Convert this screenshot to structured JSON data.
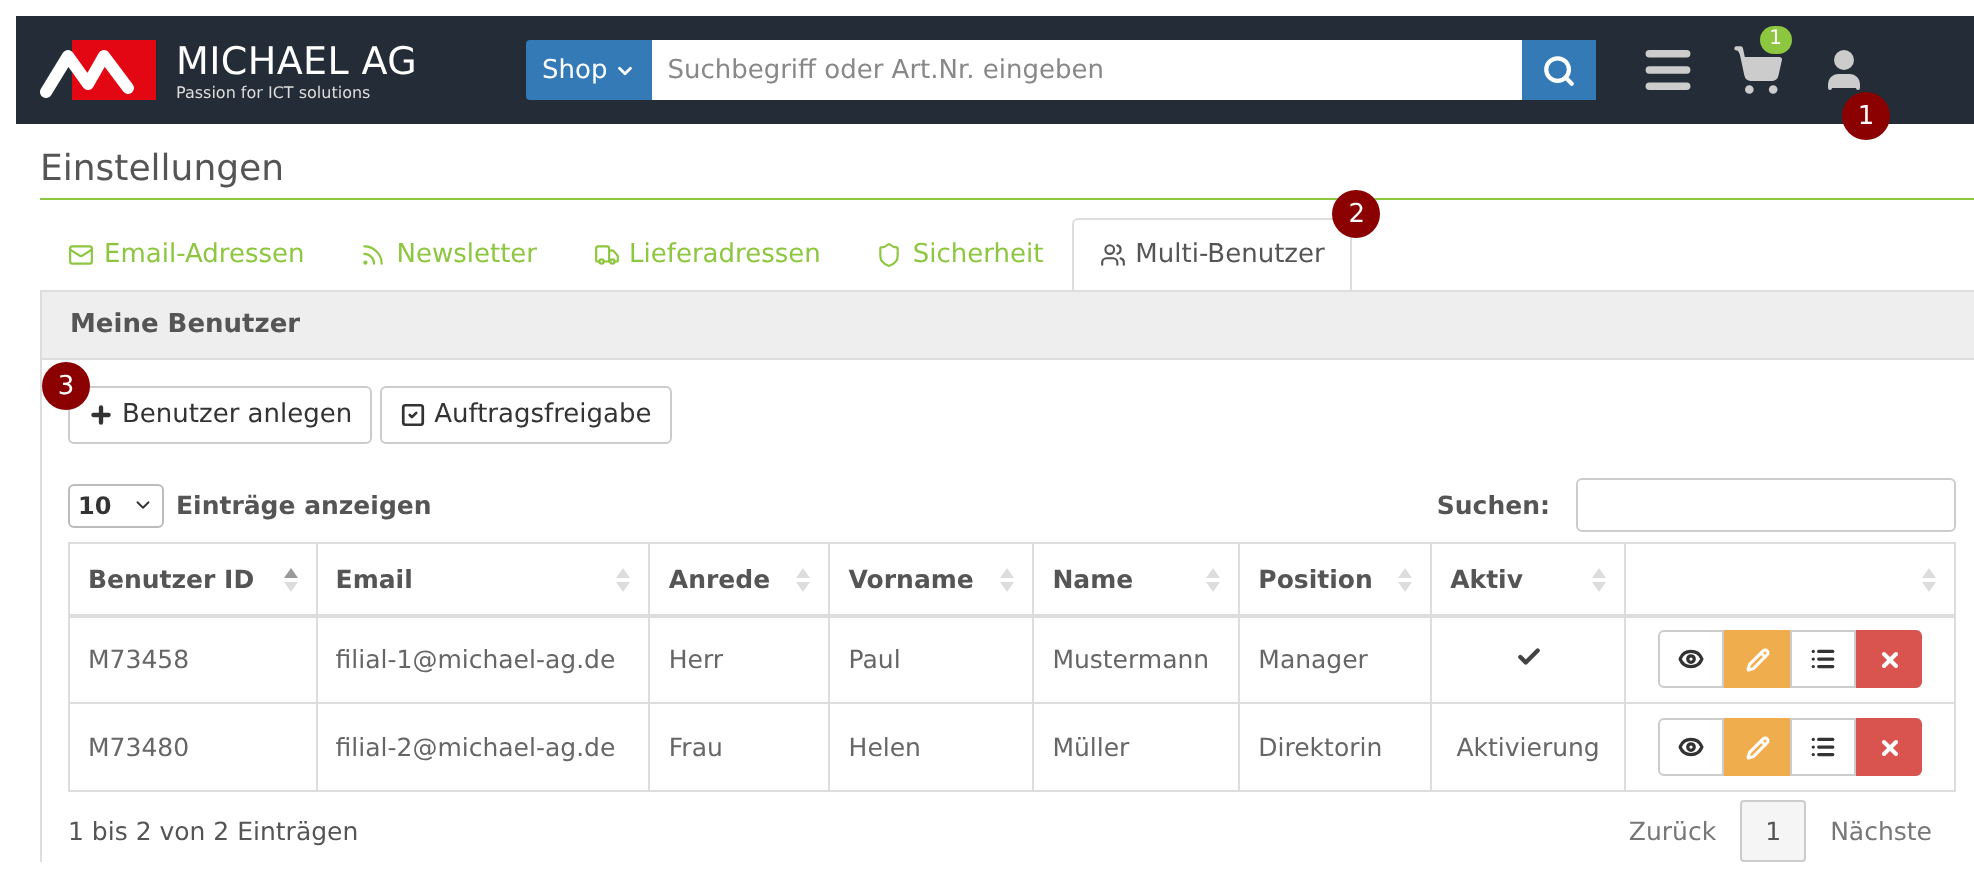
{
  "navbar": {
    "brand": "MICHAEL AG",
    "tagline": "Passion for ICT solutions",
    "shop_button": "Shop",
    "search": {
      "placeholder": "Suchbegriff oder Art.Nr. eingeben"
    },
    "cart_count": "1",
    "user_marker": "1"
  },
  "page_title": "Einstellungen",
  "tabs": [
    {
      "label": "Email-Adressen",
      "selected": false
    },
    {
      "label": "Newsletter",
      "selected": false
    },
    {
      "label": "Lieferadressen",
      "selected": false
    },
    {
      "label": "Sicherheit",
      "selected": false
    },
    {
      "label": "Multi-Benutzer",
      "selected": true,
      "marker": "2"
    }
  ],
  "panel": {
    "title": "Meine Benutzer",
    "buttons": [
      {
        "label": "Benutzer anlegen",
        "marker": "3"
      },
      {
        "label": "Auftragsfreigabe"
      }
    ],
    "page_length": "10",
    "length_label": "Einträge anzeigen",
    "search_label": "Suchen:",
    "table": {
      "columns": [
        {
          "label": "Benutzer ID",
          "sorted": true
        },
        {
          "label": "Email",
          "sorted": false
        },
        {
          "label": "Anrede",
          "sorted": false
        },
        {
          "label": "Vorname",
          "sorted": false
        },
        {
          "label": "Name",
          "sorted": false
        },
        {
          "label": "Position",
          "sorted": false
        },
        {
          "label": "Aktiv",
          "sorted": false
        },
        {
          "sorted": false
        }
      ],
      "rows": [
        {
          "id": "M73458",
          "email": "filial-1@michael-ag.de",
          "salutation": "Herr",
          "first_name": "Paul",
          "name": "Mustermann",
          "position": "Manager",
          "active": true
        },
        {
          "id": "M73480",
          "email": "filial-2@michael-ag.de",
          "salutation": "Frau",
          "first_name": "Helen",
          "name": "Müller",
          "position": "Direktorin",
          "active": false,
          "activate_label": "Aktivierung"
        }
      ]
    },
    "info": "1 bis 2 von 2 Einträgen",
    "pagination": {
      "previous": "Zurück",
      "pages": [
        "1"
      ],
      "next": "Nächste"
    }
  }
}
